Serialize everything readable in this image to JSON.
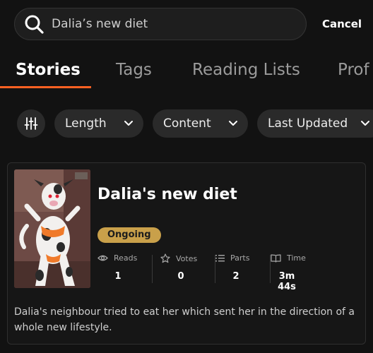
{
  "search": {
    "query": "Dalia’s new diet",
    "cancel_label": "Cancel"
  },
  "tabs": [
    {
      "label": "Stories",
      "active": true
    },
    {
      "label": "Tags",
      "active": false
    },
    {
      "label": "Reading Lists",
      "active": false
    },
    {
      "label": "Prof",
      "active": false
    }
  ],
  "filters": [
    {
      "label": "Length"
    },
    {
      "label": "Content"
    },
    {
      "label": "Last Updated"
    }
  ],
  "story": {
    "title": "Dalia's new diet",
    "status": "Ongoing",
    "stats": {
      "reads": {
        "label": "Reads",
        "value": "1"
      },
      "votes": {
        "label": "Votes",
        "value": "0"
      },
      "parts": {
        "label": "Parts",
        "value": "2"
      },
      "time": {
        "label": "Time",
        "value": "3m 44s"
      }
    },
    "description": "Dalia's neighbour tried to eat her which sent her in the direction of a whole new lifestyle."
  },
  "colors": {
    "accent": "#ff6122",
    "badge": "#c9a04a",
    "background": "#121212"
  }
}
